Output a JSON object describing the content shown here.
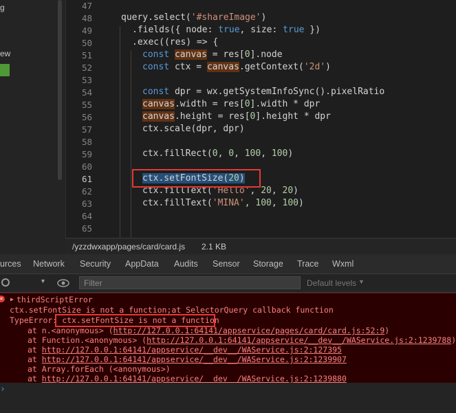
{
  "sidebar": {
    "items": [
      "g",
      "ew"
    ]
  },
  "editor": {
    "line_numbers": [
      "47",
      "48",
      "49",
      "50",
      "51",
      "52",
      "53",
      "54",
      "55",
      "56",
      "57",
      "58",
      "59",
      "60",
      "61",
      "62",
      "63",
      "64",
      "65"
    ],
    "active_line": "61",
    "lines": {
      "l48": {
        "a": "query.select(",
        "b": "'#shareImage'",
        "c": ")"
      },
      "l49": {
        "a": ".fields({ node: ",
        "b": "true",
        "c": ", size: ",
        "d": "true",
        "e": " })"
      },
      "l50": {
        "a": ".exec((res) => {"
      },
      "l51": {
        "a": "const",
        "b": "canvas",
        "c": " = res[",
        "d": "0",
        "e": "].node"
      },
      "l52": {
        "a": "const",
        "b": " ctx = ",
        "c": "canvas",
        "d": ".getContext(",
        "e": "'2d'",
        "f": ")"
      },
      "l54": {
        "a": "const",
        "b": " dpr = wx.getSystemInfoSync().pixelRatio"
      },
      "l55": {
        "a": "canvas",
        "b": ".width = res[",
        "c": "0",
        "d": "].width * dpr"
      },
      "l56": {
        "a": "canvas",
        "b": ".height = res[",
        "c": "0",
        "d": "].height * dpr"
      },
      "l57": {
        "a": "ctx.scale(dpr, dpr)"
      },
      "l59": {
        "a": "ctx.fillRect(",
        "b": "0",
        "c": ", ",
        "d": "0",
        "e": ", ",
        "f": "100",
        "g": ", ",
        "h": "100",
        "i": ")"
      },
      "l61": {
        "a": "ctx.setFontSize(",
        "b": "20",
        "c": ")"
      },
      "l62": {
        "a": "ctx.fillText(",
        "b": "'Hello'",
        "c": ", ",
        "d": "20",
        "e": ", ",
        "f": "20",
        "g": ")"
      },
      "l63": {
        "a": "ctx.fillText(",
        "b": "'MINA'",
        "c": ", ",
        "d": "100",
        "e": ", ",
        "f": "100",
        "g": ")"
      }
    }
  },
  "statusbar": {
    "path": "/yzzdwxapp/pages/card/card.js",
    "size": "2.1 KB"
  },
  "devtools_tabs": [
    "urces",
    "Network",
    "Security",
    "AppData",
    "Audits",
    "Sensor",
    "Storage",
    "Trace",
    "Wxml"
  ],
  "filter": {
    "placeholder": "Filter",
    "levels": "Default levels"
  },
  "console": {
    "group": "thirdScriptError",
    "line1": "ctx.setFontSize is not a function;at SelectorQuery callback function",
    "type_prefix": "TypeError:",
    "type_msg": "ctx.setFontSize is not a function",
    "stack": [
      {
        "prefix": "at n.<anonymous> (",
        "link": "http://127.0.0.1:64141/appservice/pages/card/card.js:52:9",
        "suffix": ")"
      },
      {
        "prefix": "at Function.<anonymous> (",
        "link": "http://127.0.0.1:64141/appservice/__dev__/WAService.js:2:1239788",
        "suffix": ")"
      },
      {
        "prefix": "at ",
        "link": "http://127.0.0.1:64141/appservice/__dev__/WAService.js:2:127395",
        "suffix": ""
      },
      {
        "prefix": "at ",
        "link": "http://127.0.0.1:64141/appservice/__dev__/WAService.js:2:1239907",
        "suffix": ""
      },
      {
        "prefix": "at Array.forEach (<anonymous>)",
        "link": "",
        "suffix": ""
      },
      {
        "prefix": "at ",
        "link": "http://127.0.0.1:64141/appservice/__dev__/WAService.js:2:1239880",
        "suffix": ""
      }
    ]
  },
  "colors": {
    "keyword": "#569cd6",
    "string": "#ce9178",
    "number": "#b5cea8",
    "error_bg": "#2a0000",
    "highlight_box": "#e53935"
  },
  "icons": [
    "error-icon",
    "expand-triangle-icon",
    "block-icon",
    "dropdown-icon",
    "eye-icon",
    "dropdown-arrow-icon",
    "prompt-chevron-icon"
  ]
}
